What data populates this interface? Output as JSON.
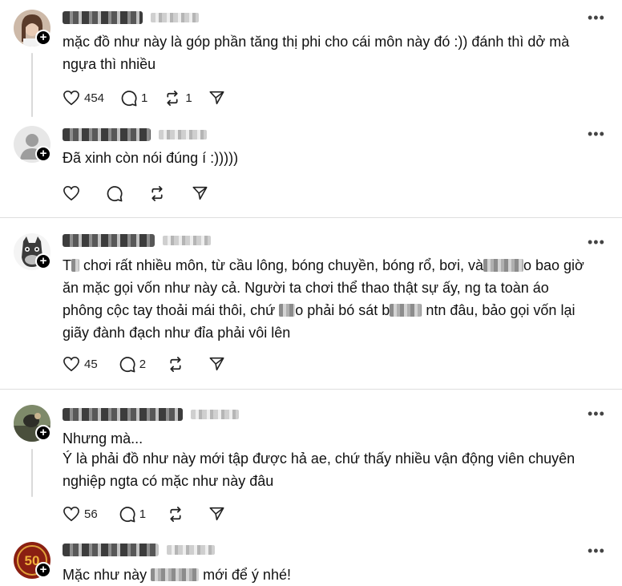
{
  "more_glyph": "•••",
  "plus_glyph": "+",
  "posts": [
    {
      "text": "mặc đồ như này là góp phần tăng thị phi cho cái môn này đó :)) đánh thì dở mà ngựa thì nhiều",
      "likes": "454",
      "replies": "1",
      "reposts": "1"
    },
    {
      "text": "Đã xinh còn nói đúng í :)))))",
      "likes": "",
      "replies": "",
      "reposts": ""
    },
    {
      "text_parts": [
        "T",
        " chơi rất nhiều môn, từ cầu lông, bóng chuyền, bóng rổ, bơi, và",
        "o bao giờ ăn mặc gọi vốn như này cả. Người ta chơi thể thao thật sự ấy, ng ta toàn áo phông cộc tay thoải mái thôi, chứ ",
        "o phải bó sát b",
        "ntn đâu, bảo gọi vốn lại giãy đành đạch như đỉa phải vôi lên"
      ],
      "likes": "45",
      "replies": "2",
      "reposts": ""
    },
    {
      "text": "Nhưng mà...",
      "text2": "Ý là phải đồ như này mới tập được hả ae, chứ thấy nhiều vận động viên chuyên nghiệp ngta có mặc như này đâu",
      "likes": "56",
      "replies": "1",
      "reposts": ""
    },
    {
      "text_parts": [
        "Mặc như này ",
        " mới để ý nhé!"
      ]
    }
  ],
  "avatar_badge_text": "50"
}
